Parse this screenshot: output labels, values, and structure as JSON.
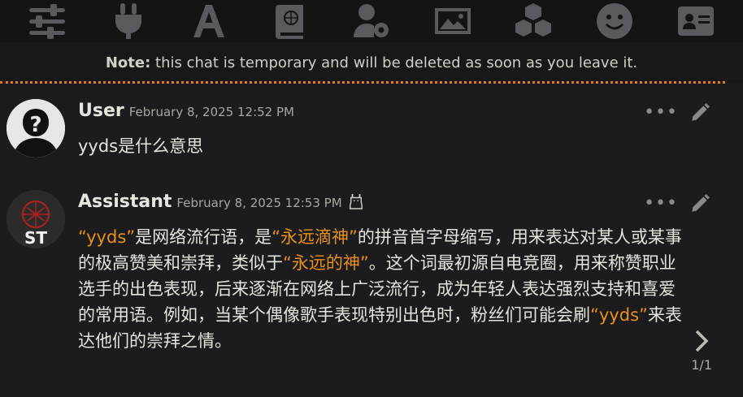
{
  "toolbar": {
    "icons": [
      "sliders-icon",
      "plug-icon",
      "font-icon",
      "book-atlas-icon",
      "user-gear-icon",
      "image-icon",
      "cubes-icon",
      "smiley-icon",
      "id-card-icon"
    ]
  },
  "note": {
    "label": "Note:",
    "text": "this chat is temporary and will be deleted as soon as you leave it."
  },
  "messages": [
    {
      "name": "User",
      "time": "February 8, 2025 12:52 PM",
      "text": "yyds是什么意思"
    },
    {
      "name": "Assistant",
      "time": "February 8, 2025 12:53 PM",
      "avatar_text": "ST",
      "text_parts": [
        {
          "t": "“yyds”",
          "h": true
        },
        {
          "t": "是网络流行语，是",
          "h": false
        },
        {
          "t": "“永远滴神”",
          "h": true
        },
        {
          "t": "的拼音首字母缩写，用来表达对某人或某事的极高赞美和崇拜，类似于",
          "h": false
        },
        {
          "t": "“永远的神”",
          "h": true
        },
        {
          "t": "。这个词最初源自电竞圈，用来称赞职业选手的出色表现，后来逐渐在网络上广泛流行，成为年轻人表达强烈支持和喜爱的常用语。例如，当某个偶像歌手表现特别出色时，粉丝们可能会刷",
          "h": false
        },
        {
          "t": "“yyds”",
          "h": true
        },
        {
          "t": "来表达他们的崇拜之情。",
          "h": false
        }
      ],
      "swipe_counter": "1/1"
    }
  ],
  "colors": {
    "accent": "#e8901c",
    "background": "#1c1c1e",
    "toolbar_icon": "#5a5a5e"
  }
}
